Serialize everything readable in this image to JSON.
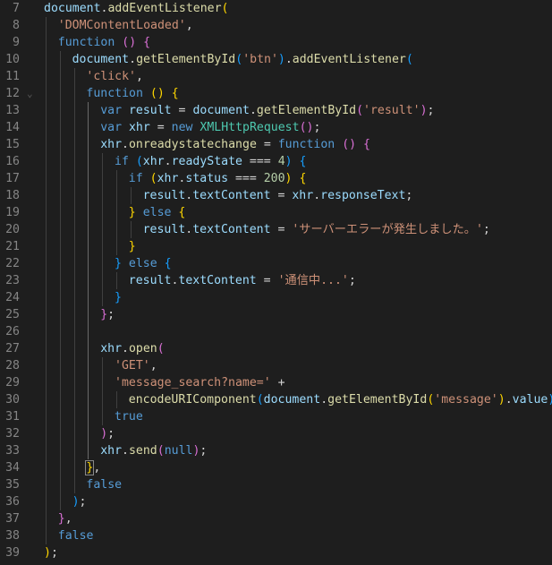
{
  "editor": {
    "lines": [
      {
        "n": "7",
        "indent": 0,
        "tokens": [
          [
            "var",
            "document"
          ],
          [
            "pun",
            "."
          ],
          [
            "fn",
            "addEventListener"
          ],
          [
            "b1",
            "("
          ]
        ]
      },
      {
        "n": "8",
        "indent": 1,
        "tokens": [
          [
            "str",
            "'DOMContentLoaded'"
          ],
          [
            "pun",
            ","
          ]
        ]
      },
      {
        "n": "9",
        "indent": 1,
        "tokens": [
          [
            "kw",
            "function"
          ],
          [
            "pun",
            " "
          ],
          [
            "b2",
            "()"
          ],
          [
            "pun",
            " "
          ],
          [
            "b2",
            "{"
          ]
        ]
      },
      {
        "n": "10",
        "indent": 2,
        "tokens": [
          [
            "var",
            "document"
          ],
          [
            "pun",
            "."
          ],
          [
            "fn",
            "getElementById"
          ],
          [
            "b3",
            "("
          ],
          [
            "str",
            "'btn'"
          ],
          [
            "b3",
            ")"
          ],
          [
            "pun",
            "."
          ],
          [
            "fn",
            "addEventListener"
          ],
          [
            "b3",
            "("
          ]
        ]
      },
      {
        "n": "11",
        "indent": 3,
        "tokens": [
          [
            "str",
            "'click'"
          ],
          [
            "pun",
            ","
          ]
        ]
      },
      {
        "n": "12",
        "indent": 3,
        "tokens": [
          [
            "kw",
            "function"
          ],
          [
            "pun",
            " "
          ],
          [
            "b1",
            "()"
          ],
          [
            "pun",
            " "
          ],
          [
            "b1",
            "{"
          ]
        ],
        "fold": true
      },
      {
        "n": "13",
        "indent": 4,
        "tokens": [
          [
            "kw",
            "var"
          ],
          [
            "pun",
            " "
          ],
          [
            "var",
            "result"
          ],
          [
            "pun",
            " = "
          ],
          [
            "var",
            "document"
          ],
          [
            "pun",
            "."
          ],
          [
            "fn",
            "getElementById"
          ],
          [
            "b2",
            "("
          ],
          [
            "str",
            "'result'"
          ],
          [
            "b2",
            ")"
          ],
          [
            "pun",
            ";"
          ]
        ]
      },
      {
        "n": "14",
        "indent": 4,
        "tokens": [
          [
            "kw",
            "var"
          ],
          [
            "pun",
            " "
          ],
          [
            "var",
            "xhr"
          ],
          [
            "pun",
            " = "
          ],
          [
            "kw",
            "new"
          ],
          [
            "pun",
            " "
          ],
          [
            "cls",
            "XMLHttpRequest"
          ],
          [
            "b2",
            "()"
          ],
          [
            "pun",
            ";"
          ]
        ]
      },
      {
        "n": "15",
        "indent": 4,
        "tokens": [
          [
            "var",
            "xhr"
          ],
          [
            "pun",
            "."
          ],
          [
            "fn",
            "onreadystatechange"
          ],
          [
            "pun",
            " = "
          ],
          [
            "kw",
            "function"
          ],
          [
            "pun",
            " "
          ],
          [
            "b2",
            "()"
          ],
          [
            "pun",
            " "
          ],
          [
            "b2",
            "{"
          ]
        ]
      },
      {
        "n": "16",
        "indent": 5,
        "tokens": [
          [
            "kw",
            "if"
          ],
          [
            "pun",
            " "
          ],
          [
            "b3",
            "("
          ],
          [
            "var",
            "xhr"
          ],
          [
            "pun",
            "."
          ],
          [
            "var",
            "readyState"
          ],
          [
            "pun",
            " === "
          ],
          [
            "num",
            "4"
          ],
          [
            "b3",
            ")"
          ],
          [
            "pun",
            " "
          ],
          [
            "b3",
            "{"
          ]
        ]
      },
      {
        "n": "17",
        "indent": 6,
        "tokens": [
          [
            "kw",
            "if"
          ],
          [
            "pun",
            " "
          ],
          [
            "b1",
            "("
          ],
          [
            "var",
            "xhr"
          ],
          [
            "pun",
            "."
          ],
          [
            "var",
            "status"
          ],
          [
            "pun",
            " === "
          ],
          [
            "num",
            "200"
          ],
          [
            "b1",
            ")"
          ],
          [
            "pun",
            " "
          ],
          [
            "b1",
            "{"
          ]
        ]
      },
      {
        "n": "18",
        "indent": 7,
        "tokens": [
          [
            "var",
            "result"
          ],
          [
            "pun",
            "."
          ],
          [
            "var",
            "textContent"
          ],
          [
            "pun",
            " = "
          ],
          [
            "var",
            "xhr"
          ],
          [
            "pun",
            "."
          ],
          [
            "var",
            "responseText"
          ],
          [
            "pun",
            ";"
          ]
        ]
      },
      {
        "n": "19",
        "indent": 6,
        "tokens": [
          [
            "b1",
            "}"
          ],
          [
            "pun",
            " "
          ],
          [
            "kw",
            "else"
          ],
          [
            "pun",
            " "
          ],
          [
            "b1",
            "{"
          ]
        ]
      },
      {
        "n": "20",
        "indent": 7,
        "tokens": [
          [
            "var",
            "result"
          ],
          [
            "pun",
            "."
          ],
          [
            "var",
            "textContent"
          ],
          [
            "pun",
            " = "
          ],
          [
            "str",
            "'サーバーエラーが発生しました。'"
          ],
          [
            "pun",
            ";"
          ]
        ]
      },
      {
        "n": "21",
        "indent": 6,
        "tokens": [
          [
            "b1",
            "}"
          ]
        ]
      },
      {
        "n": "22",
        "indent": 5,
        "tokens": [
          [
            "b3",
            "}"
          ],
          [
            "pun",
            " "
          ],
          [
            "kw",
            "else"
          ],
          [
            "pun",
            " "
          ],
          [
            "b3",
            "{"
          ]
        ]
      },
      {
        "n": "23",
        "indent": 6,
        "tokens": [
          [
            "var",
            "result"
          ],
          [
            "pun",
            "."
          ],
          [
            "var",
            "textContent"
          ],
          [
            "pun",
            " = "
          ],
          [
            "str",
            "'通信中...'"
          ],
          [
            "pun",
            ";"
          ]
        ]
      },
      {
        "n": "24",
        "indent": 5,
        "tokens": [
          [
            "b3",
            "}"
          ]
        ]
      },
      {
        "n": "25",
        "indent": 4,
        "tokens": [
          [
            "b2",
            "}"
          ],
          [
            "pun",
            ";"
          ]
        ]
      },
      {
        "n": "26",
        "indent": 4,
        "tokens": []
      },
      {
        "n": "27",
        "indent": 4,
        "tokens": [
          [
            "var",
            "xhr"
          ],
          [
            "pun",
            "."
          ],
          [
            "fn",
            "open"
          ],
          [
            "b2",
            "("
          ]
        ]
      },
      {
        "n": "28",
        "indent": 5,
        "tokens": [
          [
            "str",
            "'GET'"
          ],
          [
            "pun",
            ","
          ]
        ]
      },
      {
        "n": "29",
        "indent": 5,
        "tokens": [
          [
            "str",
            "'message_search?name='"
          ],
          [
            "pun",
            " +"
          ]
        ]
      },
      {
        "n": "30",
        "indent": 6,
        "tokens": [
          [
            "fn",
            "encodeURIComponent"
          ],
          [
            "b3",
            "("
          ],
          [
            "var",
            "document"
          ],
          [
            "pun",
            "."
          ],
          [
            "fn",
            "getElementById"
          ],
          [
            "b1",
            "("
          ],
          [
            "str",
            "'message'"
          ],
          [
            "b1",
            ")"
          ],
          [
            "pun",
            "."
          ],
          [
            "var",
            "value"
          ],
          [
            "b3",
            ")"
          ],
          [
            "pun",
            ","
          ]
        ]
      },
      {
        "n": "31",
        "indent": 5,
        "tokens": [
          [
            "kw",
            "true"
          ]
        ]
      },
      {
        "n": "32",
        "indent": 4,
        "tokens": [
          [
            "b2",
            ")"
          ],
          [
            "pun",
            ";"
          ]
        ]
      },
      {
        "n": "33",
        "indent": 4,
        "tokens": [
          [
            "var",
            "xhr"
          ],
          [
            "pun",
            "."
          ],
          [
            "fn",
            "send"
          ],
          [
            "b2",
            "("
          ],
          [
            "kw",
            "null"
          ],
          [
            "b2",
            ")"
          ],
          [
            "pun",
            ";"
          ]
        ]
      },
      {
        "n": "34",
        "indent": 3,
        "tokens": [
          [
            "b1",
            "}"
          ],
          [
            "pun",
            ","
          ]
        ],
        "match": true
      },
      {
        "n": "35",
        "indent": 3,
        "tokens": [
          [
            "kw",
            "false"
          ]
        ]
      },
      {
        "n": "36",
        "indent": 2,
        "tokens": [
          [
            "b3",
            ")"
          ],
          [
            "pun",
            ";"
          ]
        ]
      },
      {
        "n": "37",
        "indent": 1,
        "tokens": [
          [
            "b2",
            "}"
          ],
          [
            "pun",
            ","
          ]
        ]
      },
      {
        "n": "38",
        "indent": 1,
        "tokens": [
          [
            "kw",
            "false"
          ]
        ]
      },
      {
        "n": "39",
        "indent": 0,
        "tokens": [
          [
            "b1",
            ")"
          ],
          [
            "pun",
            ";"
          ]
        ]
      }
    ]
  },
  "colors": {
    "background": "#1e1e1e",
    "line_number": "#858585",
    "keyword": "#569cd6",
    "variable": "#9cdcfe",
    "function": "#dcdcaa",
    "string": "#ce9178",
    "number": "#b5cea8",
    "class": "#4ec9b0",
    "bracket_gold": "#ffd700",
    "bracket_orchid": "#da70d6",
    "bracket_blue": "#179fff"
  }
}
